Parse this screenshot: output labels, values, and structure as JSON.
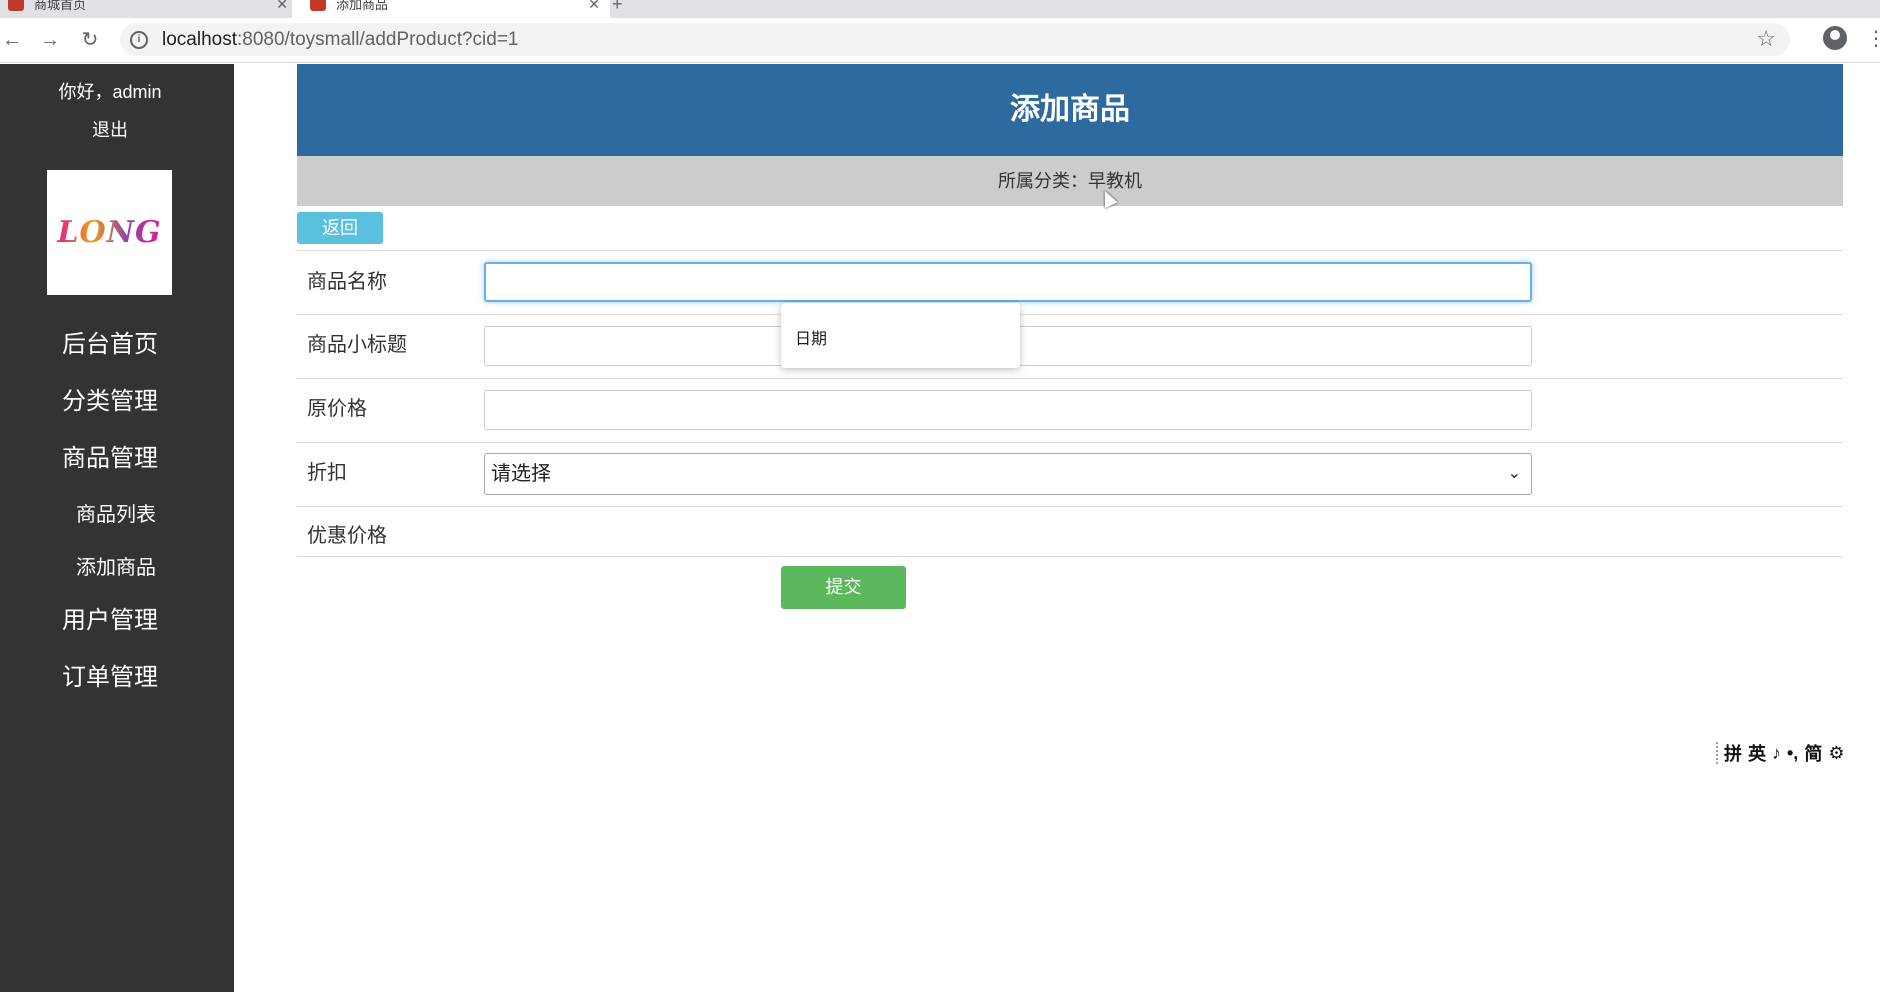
{
  "browser": {
    "tabs": [
      {
        "title": "商城首页"
      },
      {
        "title": "添加商品"
      }
    ],
    "new_tab_symbol": "+",
    "url_host": "localhost",
    "url_rest": ":8080/toysmall/addProduct?cid=1"
  },
  "sidebar": {
    "greeting": "你好，admin",
    "logout": "退出",
    "logo_text": "LONG",
    "menu": [
      {
        "label": "后台首页",
        "sub": false
      },
      {
        "label": "分类管理",
        "sub": false
      },
      {
        "label": "商品管理",
        "sub": false
      },
      {
        "label": "商品列表",
        "sub": true
      },
      {
        "label": "添加商品",
        "sub": true
      },
      {
        "label": "用户管理",
        "sub": false
      },
      {
        "label": "订单管理",
        "sub": false
      }
    ]
  },
  "page": {
    "title": "添加商品",
    "category_line": "所属分类：早教机",
    "back_button": "返回",
    "fields": {
      "name_label": "商品名称",
      "subtitle_label": "商品小标题",
      "price_label": "原价格",
      "discount_label": "折扣",
      "discount_selected": "请选择",
      "sale_price_label": "优惠价格"
    },
    "submit_button": "提交",
    "autocomplete_item": "日期"
  },
  "ime_toolbar": [
    "拼",
    "英",
    "♪",
    "•,",
    "简",
    "⚙"
  ]
}
